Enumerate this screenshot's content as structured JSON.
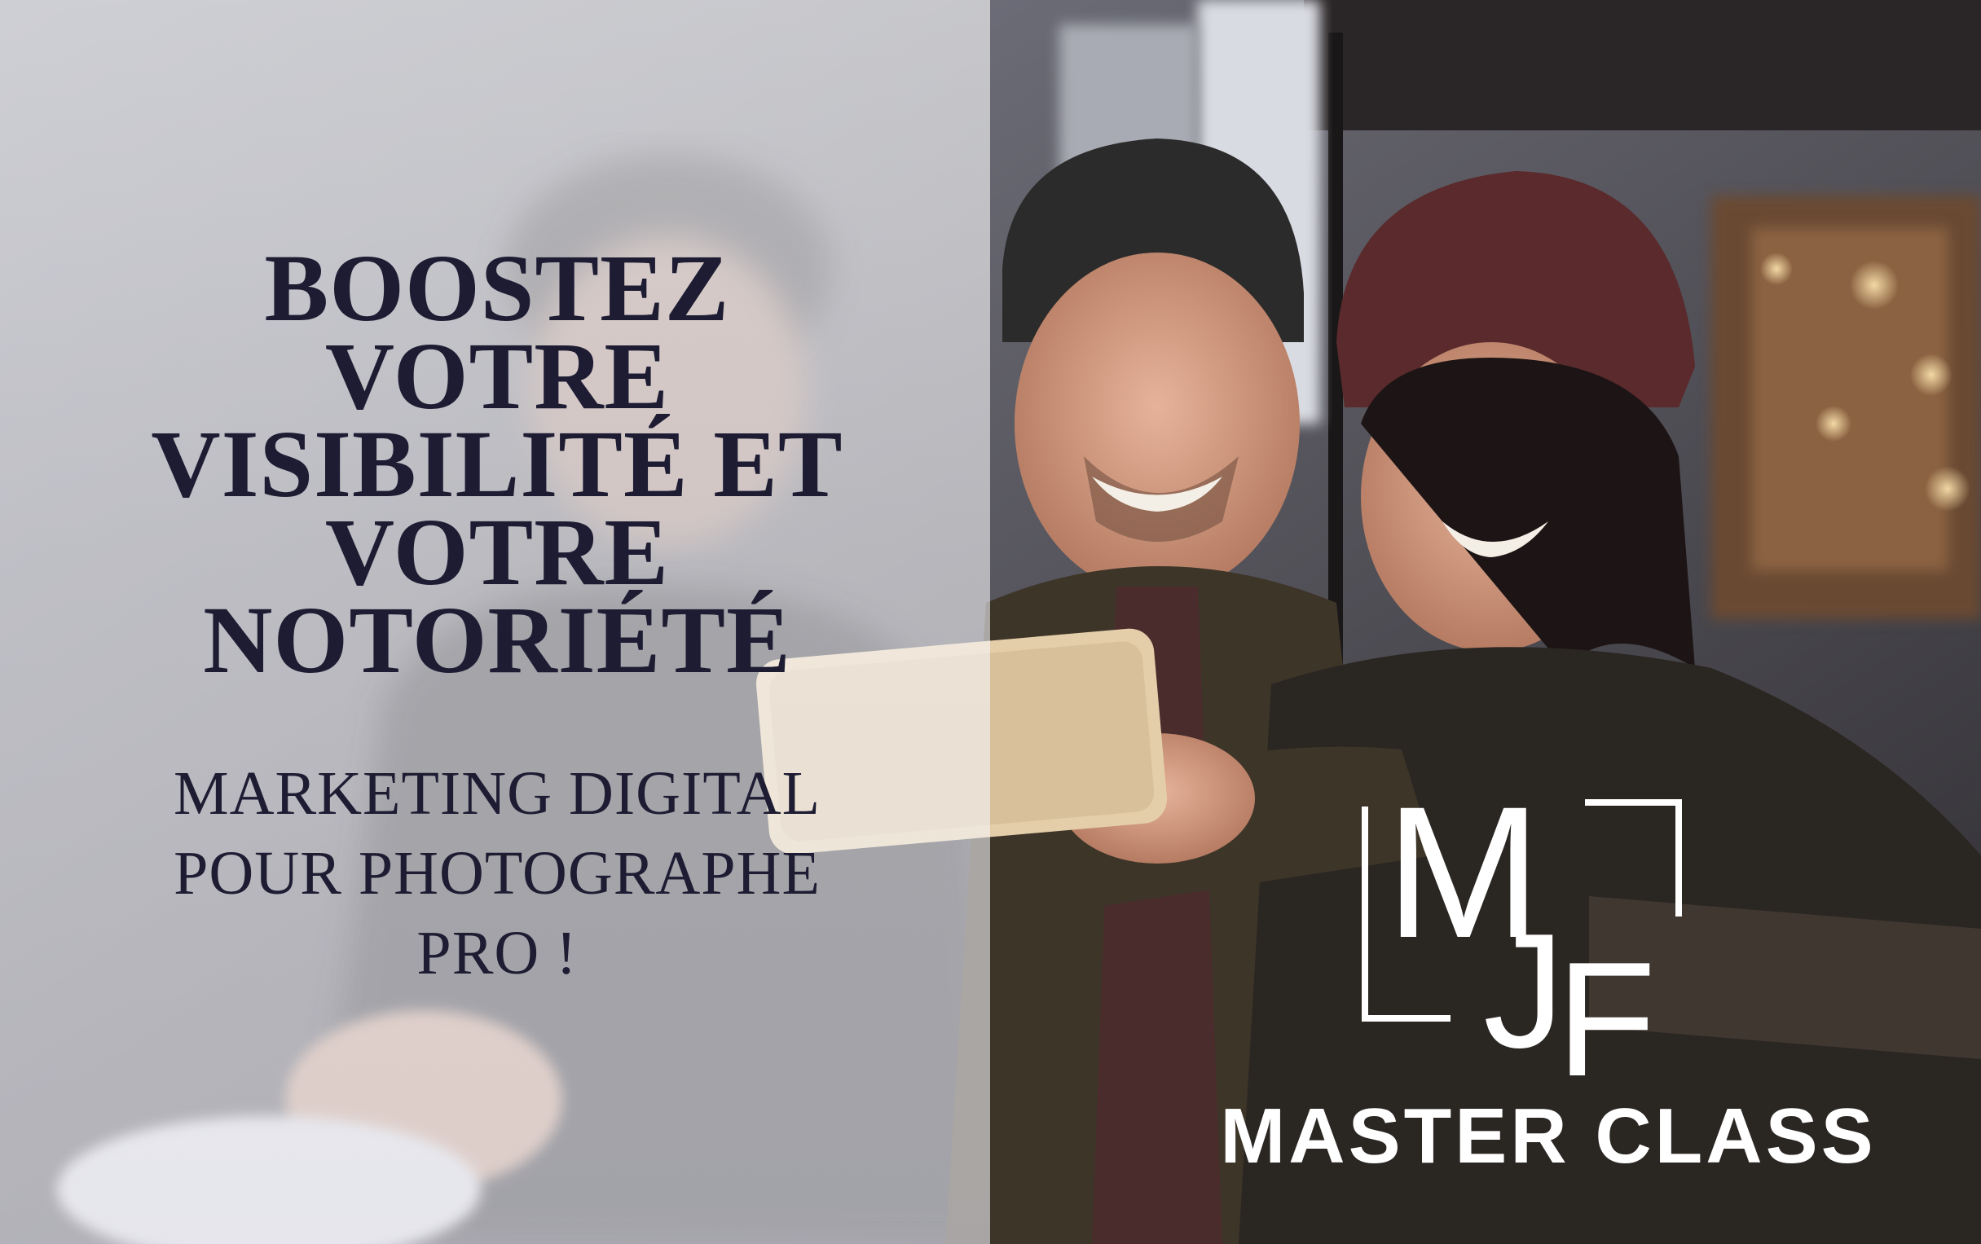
{
  "banner": {
    "headline_lines": [
      "BOOSTEZ",
      "VOTRE",
      "VISIBILITÉ ET",
      "VOTRE",
      "NOTORIÉTÉ"
    ],
    "subtitle_lines": [
      "MARKETING DIGITAL",
      "POUR PHOTOGRAPHE",
      "PRO !"
    ]
  },
  "logo": {
    "letters": [
      "M",
      "J",
      "F"
    ],
    "tagline": "MASTER CLASS",
    "color": "#ffffff"
  },
  "colors": {
    "text_dark": "#1d1c33",
    "veil": "#ffffff"
  }
}
